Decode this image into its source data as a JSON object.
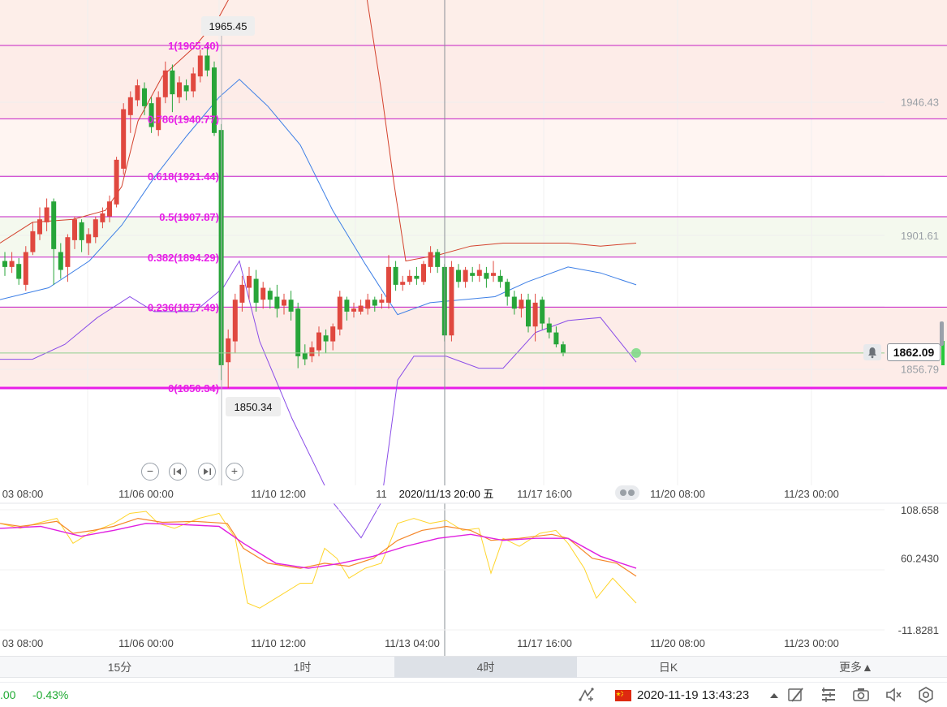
{
  "fib_levels": [
    {
      "label": "1(1965.40)",
      "price": 1965.4
    },
    {
      "label": "0.786(1940.77)",
      "price": 1940.77
    },
    {
      "label": "0.618(1921.44)",
      "price": 1921.44
    },
    {
      "label": "0.5(1907.87)",
      "price": 1907.87
    },
    {
      "label": "0.382(1894.29)",
      "price": 1894.29
    },
    {
      "label": "0.236(1877.49)",
      "price": 1877.49
    },
    {
      "label": "0(1850.34)",
      "price": 1850.34
    }
  ],
  "price_axis": {
    "labels": [
      {
        "text": "1946.43",
        "price": 1946.43
      },
      {
        "text": "1901.61",
        "price": 1901.61
      },
      {
        "text": "1856.79",
        "price": 1856.79
      }
    ],
    "current_price": "1862.09"
  },
  "high_marker": "1965.45",
  "low_marker": "1850.34",
  "crosshair_time": "2020/11/13 20:00 五",
  "main_time_axis": [
    "03 08:00",
    "11/06 00:00",
    "11/10 12:00",
    "11",
    "11/17 16:00",
    "11/20 08:00",
    "11/23 00:00"
  ],
  "osc_time_axis": [
    "03 08:00",
    "11/06 00:00",
    "11/10 12:00",
    "11/13 04:00",
    "11/17 16:00",
    "11/20 08:00",
    "11/23 00:00"
  ],
  "osc_axis": [
    "108.658",
    "60.2430",
    "-11.8281"
  ],
  "timeframes": [
    "15分",
    "1时",
    "4时",
    "日K",
    "更多▲"
  ],
  "active_timeframe": "4时",
  "status": {
    "price_fragment": ".00",
    "change": "-0.43%",
    "datetime": "2020-11-19 13:43:23"
  },
  "colors": {
    "up": "#e0483f",
    "down": "#27a539",
    "fib": "#c51fc5",
    "fib_zero": "#e81ee8",
    "boll_upper": "#d4432e",
    "boll_mid": "#3d7fe6",
    "boll_lower": "#8a4de8",
    "osc_k": "#ffd52a",
    "osc_d": "#f5872a",
    "osc_j": "#e020e0"
  },
  "icons": [
    "zoom-out-icon",
    "jump-start-icon",
    "jump-end-icon",
    "zoom-in-icon",
    "drawing-tool-icon",
    "china-flag-icon",
    "pen-icon",
    "layout-list-icon",
    "camera-icon",
    "mute-icon",
    "settings-icon",
    "bell-icon"
  ]
}
